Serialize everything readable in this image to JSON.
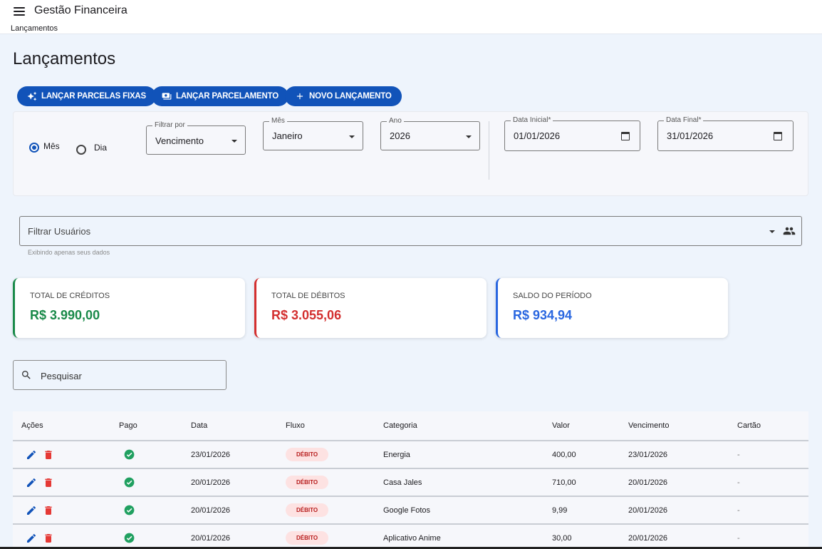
{
  "app": {
    "title": "Gestão Financeira",
    "breadcrumb": "Lançamentos"
  },
  "page": {
    "title": "Lançamentos"
  },
  "actions": {
    "fixed_installments": "LANÇAR PARCELAS FIXAS",
    "installments": "LANÇAR PARCELAMENTO",
    "new_entry": "NOVO LANÇAMENTO"
  },
  "filters": {
    "mode_month": "Mês",
    "mode_day": "Dia",
    "filter_by_label": "Filtrar por",
    "filter_by_value": "Vencimento",
    "month_label": "Mês",
    "month_value": "Janeiro",
    "year_label": "Ano",
    "year_value": "2026",
    "start_label": "Data Inicial*",
    "start_value": "01/01/2026",
    "end_label": "Data Final*",
    "end_value": "31/01/2026"
  },
  "users": {
    "placeholder": "Filtrar Usuários",
    "helper": "Exibindo apenas seus dados"
  },
  "summary": {
    "credits_label": "TOTAL DE CRÉDITOS",
    "credits_value": "R$ 3.990,00",
    "debits_label": "TOTAL DE DÉBITOS",
    "debits_value": "R$ 3.055,06",
    "balance_label": "SALDO DO PERÍODO",
    "balance_value": "R$ 934,94"
  },
  "colors": {
    "primary": "#1153b9",
    "credit": "#1a8a4a",
    "debit": "#d32f2f",
    "balance": "#2a67e0",
    "paid": "#20a060"
  },
  "search": {
    "placeholder": "Pesquisar"
  },
  "table": {
    "headers": {
      "actions": "Ações",
      "paid": "Pago",
      "date": "Data",
      "flow": "Fluxo",
      "category": "Categoria",
      "value": "Valor",
      "due": "Vencimento",
      "card": "Cartão"
    },
    "rows": [
      {
        "date": "23/01/2026",
        "flow": "DÉBITO",
        "category": "Energia",
        "value": "400,00",
        "due": "23/01/2026",
        "card": "-"
      },
      {
        "date": "20/01/2026",
        "flow": "DÉBITO",
        "category": "Casa Jales",
        "value": "710,00",
        "due": "20/01/2026",
        "card": "-"
      },
      {
        "date": "20/01/2026",
        "flow": "DÉBITO",
        "category": "Google Fotos",
        "value": "9,99",
        "due": "20/01/2026",
        "card": "-"
      },
      {
        "date": "20/01/2026",
        "flow": "DÉBITO",
        "category": "Aplicativo Anime",
        "value": "30,00",
        "due": "20/01/2026",
        "card": "-"
      }
    ]
  }
}
